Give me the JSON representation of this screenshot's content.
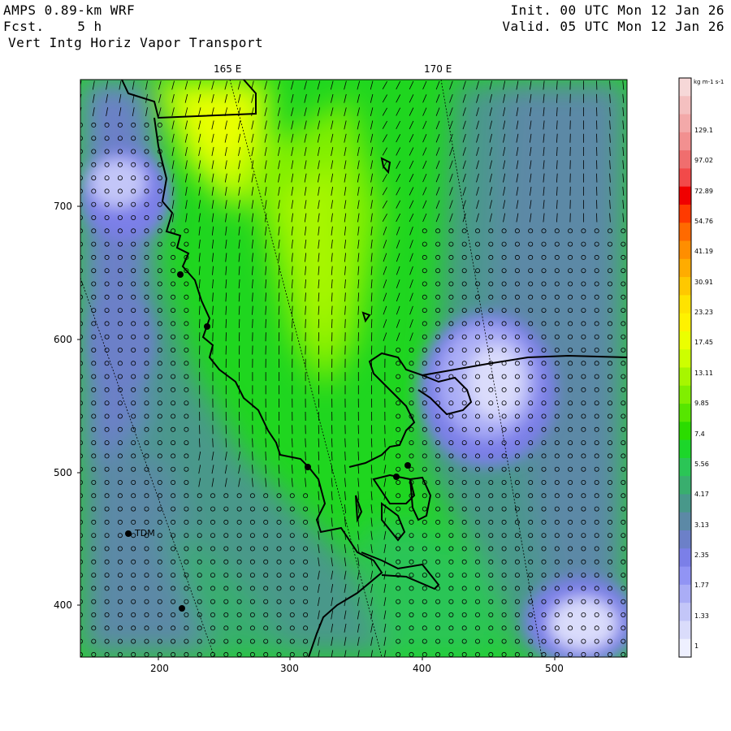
{
  "header": {
    "model": "AMPS 0.89-km WRF",
    "forecast": "Fcst.    5 h",
    "field": "Vert Intg Horiz Vapor Transport",
    "init": "Init. 00 UTC Mon 12 Jan 26",
    "valid": "Valid. 05 UTC Mon 12 Jan 26"
  },
  "top_axis": [
    "165 E",
    "170 E"
  ],
  "x_axis": [
    "200",
    "300",
    "400",
    "500"
  ],
  "y_axis": [
    "700",
    "600",
    "500",
    "400"
  ],
  "colorbar": {
    "units": "kg m-1 s-1",
    "labels": [
      "129.1",
      "97.02",
      "72.89",
      "54.76",
      "41.19",
      "30.91",
      "23.23",
      "17.45",
      "13.11",
      "9.85",
      "7.4",
      "5.56",
      "4.17",
      "3.13",
      "2.35",
      "1.77",
      "1.33",
      "1"
    ],
    "colors": [
      "#f6d8d8",
      "#f4c0c0",
      "#f3a9a9",
      "#f29090",
      "#f06e6e",
      "#f24a4a",
      "#f00000",
      "#ff3a00",
      "#ff6a00",
      "#ff8e00",
      "#ffac00",
      "#ffc800",
      "#ffe300",
      "#fff200",
      "#ebff00",
      "#cdff00",
      "#a7f600",
      "#80ef00",
      "#56e600",
      "#2bdc00",
      "#1cd62a",
      "#2bc556",
      "#39ae6e",
      "#48988a",
      "#5c89a6",
      "#6c80c8",
      "#7b7fe8",
      "#9194f4",
      "#aaadf6",
      "#c3c6f8",
      "#dadcfb",
      "#eef0ff"
    ]
  },
  "stations": [
    {
      "label": "TDM"
    }
  ]
}
